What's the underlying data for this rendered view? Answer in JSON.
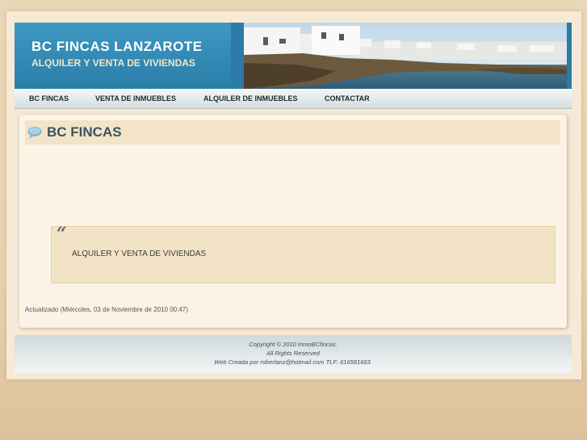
{
  "header": {
    "title": "BC FINCAS LANZAROTE",
    "subtitle": "ALQUILER Y VENTA DE VIVIENDAS",
    "photo_icon": "coastal-village-photo"
  },
  "nav": {
    "items": [
      {
        "label": "BC FINCAS"
      },
      {
        "label": "VENTA DE INMUEBLES"
      },
      {
        "label": "ALQUILER DE INMUEBLES"
      },
      {
        "label": "CONTACTAR"
      }
    ]
  },
  "main": {
    "title": "BC FINCAS",
    "title_icon": "speech-bubble-icon",
    "quote": {
      "mark": "“",
      "text": "ALQUILER Y VENTA DE VIVIENDAS"
    },
    "updated": "Actualizado (Miércoles, 03 de Noviembre de 2010 00:47)"
  },
  "footer": {
    "line1": "Copyright © 2010 InmoBCfincas.",
    "line2": "All Rights Reserved",
    "line3": "Web Creada por roberlanz@hotmail.com TLF: 616581663."
  },
  "colors": {
    "header_blue": "#2f86b3",
    "title_text": "#3a5560",
    "background": "#ead7b8"
  }
}
